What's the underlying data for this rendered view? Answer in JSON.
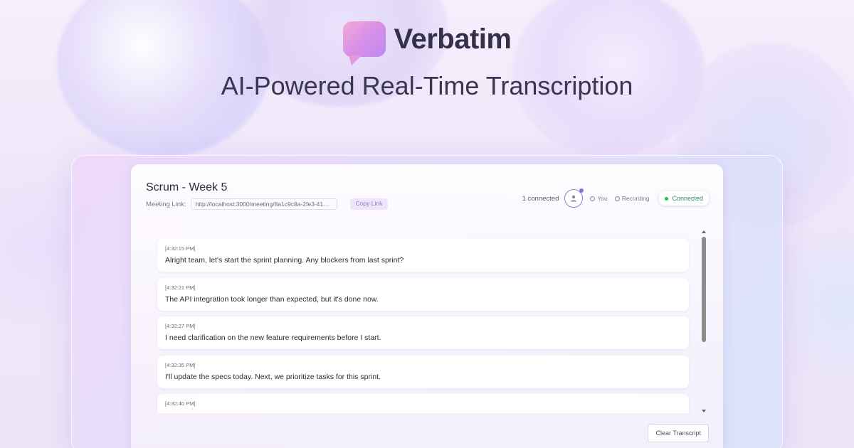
{
  "brand": {
    "name": "Verbatim",
    "tagline": "AI-Powered Real-Time Transcription"
  },
  "meeting": {
    "title": "Scrum - Week 5",
    "link_label": "Meeting Link:",
    "link_value": "http://localhost:3000/meeting/8a1c9c8a-2fe3-41ac...",
    "copy_label": "Copy Link"
  },
  "status": {
    "connected_count": "1 connected",
    "legend_you": "You",
    "legend_recording": "Recording",
    "connection": "Connected",
    "connection_color": "#22c05a"
  },
  "transcript": [
    {
      "time": "[4:32:15 PM]",
      "text": "Alright team, let's start the sprint planning. Any blockers from last sprint?"
    },
    {
      "time": "[4:32:21 PM]",
      "text": "The API integration took longer than expected, but it's done now."
    },
    {
      "time": "[4:32:27 PM]",
      "text": "I need clarification on the new feature requirements before I start."
    },
    {
      "time": "[4:32:35 PM]",
      "text": "I'll update the specs today. Next, we prioritize tasks for this sprint."
    },
    {
      "time": "[4:32:40 PM]",
      "text": ""
    }
  ],
  "actions": {
    "clear_label": "Clear Transcript"
  },
  "icons": {
    "logo": "chat-bubble-icon",
    "avatar": "user-icon",
    "scroll_up": "arrow-up-icon",
    "scroll_down": "arrow-down-icon"
  }
}
